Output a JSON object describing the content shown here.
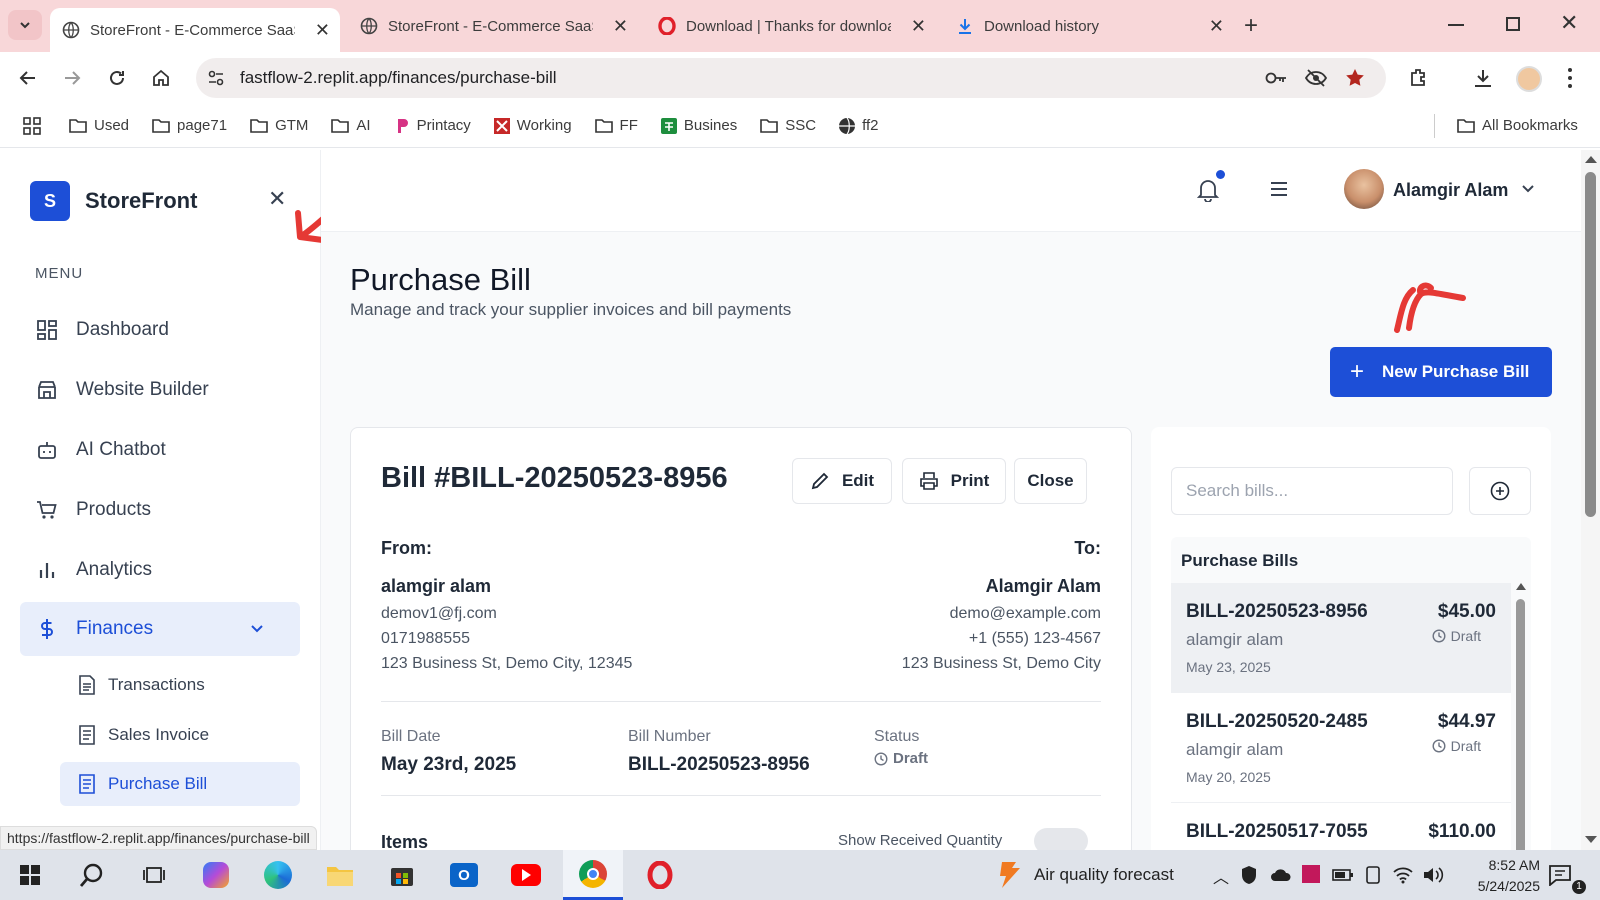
{
  "browser": {
    "tabs": [
      {
        "title": "StoreFront - E-Commerce SaaS"
      },
      {
        "title": "StoreFront - E-Commerce SaaS"
      },
      {
        "title": "Download | Thanks for downloading"
      },
      {
        "title": "Download history"
      }
    ],
    "url": "fastflow-2.replit.app/finances/purchase-bill",
    "bookmarks": [
      "Used",
      "page71",
      "GTM",
      "AI",
      "Printacy",
      "Working",
      "FF",
      "Busines",
      "SSC",
      "ff2"
    ],
    "all_bookmarks": "All Bookmarks",
    "status_url": "https://fastflow-2.replit.app/finances/purchase-bill"
  },
  "sidebar": {
    "brand_letter": "S",
    "brand": "StoreFront",
    "menu_heading": "MENU",
    "items": [
      {
        "label": "Dashboard"
      },
      {
        "label": "Website Builder"
      },
      {
        "label": "AI Chatbot"
      },
      {
        "label": "Products"
      },
      {
        "label": "Analytics"
      },
      {
        "label": "Finances"
      }
    ],
    "subitems": [
      {
        "label": "Transactions"
      },
      {
        "label": "Sales Invoice"
      },
      {
        "label": "Purchase Bill"
      }
    ]
  },
  "header": {
    "user_name": "Alamgir Alam"
  },
  "page": {
    "title": "Purchase Bill",
    "subtitle": "Manage and track your supplier invoices and bill payments",
    "new_button": "New Purchase Bill"
  },
  "bill": {
    "heading": "Bill #BILL-20250523-8956",
    "edit": "Edit",
    "print": "Print",
    "close": "Close",
    "from_label": "From:",
    "to_label": "To:",
    "from": {
      "name": "alamgir alam",
      "email": "demov1@fj.com",
      "phone": "0171988555",
      "address": "123 Business St, Demo City, 12345"
    },
    "to": {
      "name": "Alamgir Alam",
      "email": "demo@example.com",
      "phone": "+1 (555) 123-4567",
      "address": "123 Business St, Demo City"
    },
    "date_label": "Bill Date",
    "date": "May 23rd, 2025",
    "number_label": "Bill Number",
    "number": "BILL-20250523-8956",
    "status_label": "Status",
    "status": "Draft",
    "items_label": "Items",
    "show_received": "Show Received Quantity"
  },
  "list": {
    "search_placeholder": "Search bills...",
    "heading": "Purchase Bills",
    "bills": [
      {
        "id": "BILL-20250523-8956",
        "amount": "$45.00",
        "supplier": "alamgir alam",
        "date": "May 23, 2025",
        "status": "Draft"
      },
      {
        "id": "BILL-20250520-2485",
        "amount": "$44.97",
        "supplier": "alamgir alam",
        "date": "May 20, 2025",
        "status": "Draft"
      },
      {
        "id": "BILL-20250517-7055",
        "amount": "$110.00",
        "supplier": "",
        "date": "",
        "status": ""
      }
    ]
  },
  "taskbar": {
    "weather": "Air quality forecast",
    "time": "8:52 AM",
    "date": "5/24/2025"
  },
  "colors": {
    "primary": "#1d4fd7",
    "tab_bg": "#f8d7d9",
    "annotation": "#e53935"
  }
}
